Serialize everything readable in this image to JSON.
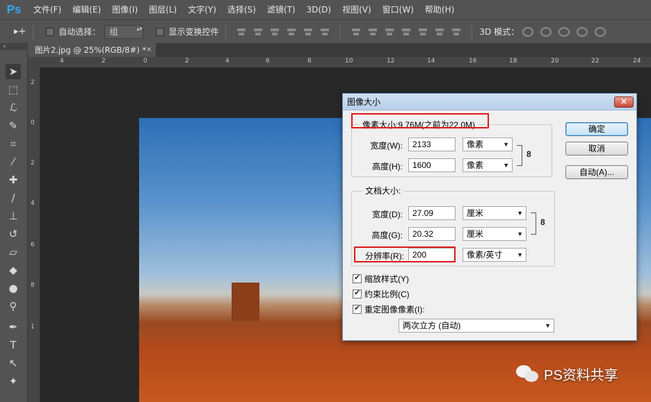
{
  "app": {
    "logo": "Ps"
  },
  "menu": [
    "文件(F)",
    "编辑(E)",
    "图像(I)",
    "图层(L)",
    "文字(Y)",
    "选择(S)",
    "滤镜(T)",
    "3D(D)",
    "视图(V)",
    "窗口(W)",
    "帮助(H)"
  ],
  "options": {
    "move_tool_glyph": "▸+",
    "auto_select_label": "自动选择：",
    "auto_select_value": "组",
    "show_transform_label": "显示变换控件",
    "mode_3d_label": "3D 模式："
  },
  "document_tab": {
    "title": "图片2.jpg @ 25%(RGB/8#) *",
    "close": "×"
  },
  "rulers": {
    "top": [
      "4",
      "2",
      "0",
      "2",
      "4",
      "6",
      "8",
      "10",
      "12",
      "14",
      "16",
      "18",
      "20",
      "22",
      "24"
    ],
    "left": [
      "2",
      "0",
      "2",
      "4",
      "6",
      "8",
      "1"
    ]
  },
  "dialog": {
    "title": "图像大小",
    "close": "✕",
    "pixel_dimensions": {
      "title": "像素大小:9.76M(之前为22.0M)",
      "width_label": "宽度(W):",
      "width_value": "2133",
      "width_unit": "像素",
      "height_label": "高度(H):",
      "height_value": "1600",
      "height_unit": "像素"
    },
    "document_size": {
      "title": "文档大小:",
      "width_label": "宽度(D):",
      "width_value": "27.09",
      "width_unit": "厘米",
      "height_label": "高度(G):",
      "height_value": "20.32",
      "height_unit": "厘米",
      "resolution_label": "分辨率(R):",
      "resolution_value": "200",
      "resolution_unit": "像素/英寸"
    },
    "checkboxes": [
      {
        "label": "缩放样式(Y)",
        "checked": true
      },
      {
        "label": "约束比例(C)",
        "checked": true
      },
      {
        "label": "重定图像像素(I):",
        "checked": true
      }
    ],
    "resample_method": "两次立方 (自动)",
    "buttons": {
      "ok": "确定",
      "cancel": "取消",
      "auto": "自动(A)..."
    },
    "highlight_color": "#e01818"
  },
  "watermark": {
    "text": "PS资料共享"
  }
}
